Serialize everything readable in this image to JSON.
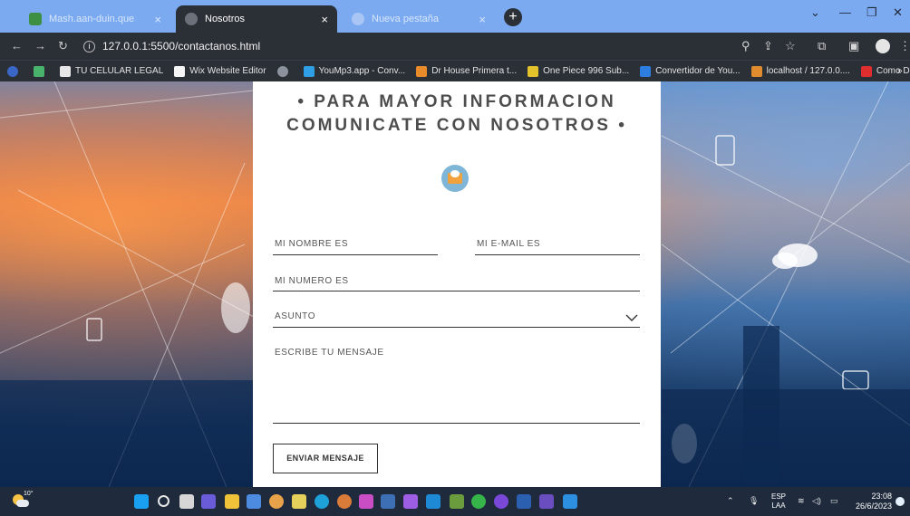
{
  "browser": {
    "tabs": [
      {
        "label": "Mash.aan-duin.que",
        "active": false
      },
      {
        "label": "Nosotros",
        "active": true
      },
      {
        "label": "Nueva pestaña",
        "active": false
      }
    ],
    "address": "127.0.0.1:5500/contactanos.html",
    "bookmarks": [
      "TU CELULAR LEGAL",
      "Wix Website Editor",
      "YouMp3.app - Conv...",
      "Dr House Primera t...",
      "One Piece 996 Sub...",
      "Convertidor de You...",
      "localhost / 127.0.0....",
      "Como Descargar H..."
    ],
    "overflow_label": "»"
  },
  "page": {
    "heading_line1": "• PARA MAYOR INFORMACION",
    "heading_line2": "COMUNICATE CON NOSOTROS •",
    "form": {
      "name_label": "MI NOMBRE ES",
      "email_label": "MI E-MAIL ES",
      "phone_label": "MI NUMERO ES",
      "subject_label": "ASUNTO",
      "message_label": "ESCRIBE TU MENSAJE",
      "submit_label": "ENVIAR MENSAJE"
    }
  },
  "taskbar": {
    "weather_temp": "10°",
    "language_line1": "ESP",
    "language_line2": "LAA",
    "time": "23:08",
    "date": "26/6/2023"
  }
}
